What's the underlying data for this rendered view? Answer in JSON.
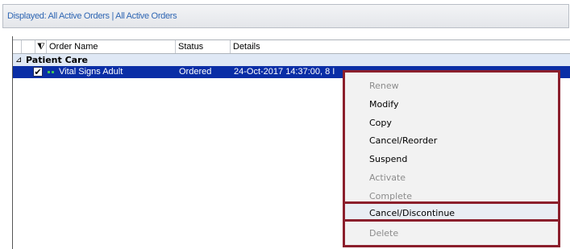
{
  "topbar": {
    "text": "Displayed: All Active Orders | All Active Orders"
  },
  "columns": {
    "filter_icon": "⧨",
    "order_name": "Order Name",
    "status": "Status",
    "details": "Details"
  },
  "group": {
    "arrow": "⊿",
    "label": "Patient Care"
  },
  "order": {
    "name": "Vital Signs Adult",
    "status": "Ordered",
    "details": "24-Oct-2017 14:37:00, 8 I"
  },
  "menu": {
    "items": [
      {
        "label": "Renew",
        "enabled": false
      },
      {
        "label": "Modify",
        "enabled": true
      },
      {
        "label": "Copy",
        "enabled": true
      },
      {
        "label": "Cancel/Reorder",
        "enabled": true
      },
      {
        "label": "Suspend",
        "enabled": true
      },
      {
        "label": "Activate",
        "enabled": false
      },
      {
        "label": "Complete",
        "enabled": false
      },
      {
        "label": "Cancel/Discontinue",
        "enabled": true
      },
      {
        "label": "Delete",
        "enabled": false
      }
    ]
  },
  "colors": {
    "selection": "#0a2ea6",
    "group_bg": "#dfe8f5",
    "highlight_border": "#8b1f2c",
    "link": "#2f66b3"
  }
}
